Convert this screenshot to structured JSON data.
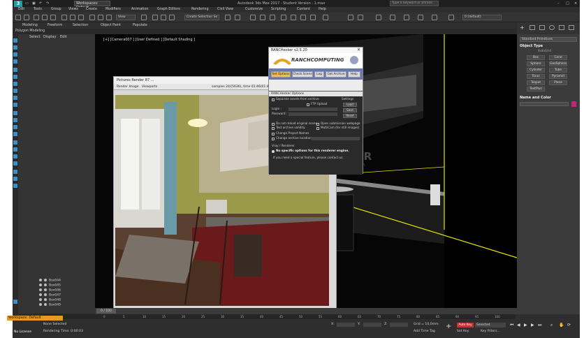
{
  "window": {
    "title": "Autodesk 3ds Max 2017 - Student Version  :  1.max",
    "logo_text": "3",
    "workspace_label": "Workspaces: Default",
    "search_placeholder": "Type a keyword or phrase"
  },
  "menu": {
    "items": [
      "Edit",
      "Tools",
      "Group",
      "Views",
      "Create",
      "Modifiers",
      "Animation",
      "Graph Editors",
      "Rendering",
      "Civil View",
      "Customize",
      "Scripting",
      "Content",
      "Help"
    ]
  },
  "toolbar": {
    "view_dropdown": "View",
    "selection_set_placeholder": "Create Selection Se",
    "layer_default": "0 (default)"
  },
  "ribbon": {
    "tabs": [
      "Modeling",
      "Freeform",
      "Selection",
      "Object Paint",
      "Populate"
    ],
    "sub_label": "Polygon Modeling"
  },
  "scene_explorer": {
    "menu": [
      "Select",
      "Display",
      "Edit"
    ],
    "rows": [
      "Box044",
      "Box045",
      "Box046",
      "Box047",
      "Box048",
      "Box049"
    ]
  },
  "viewport": {
    "label": "[+] [Camera007 ] [User Defined ] [Default Shading ]",
    "watermark": "FILECR",
    "watermark_sub": ".com"
  },
  "frame_buffer": {
    "title": "Pictures Render 87 ...",
    "area_label": "Render Image",
    "area_value": "Viewports",
    "status": "samples 24/(5636), time 01:46(01:49:00), noise 3%"
  },
  "ranch": {
    "title": "RANCHecker v2.5.20",
    "brand": "RANCHCOMPUTING",
    "tabs": [
      "Set Options",
      "Check Scene",
      "Log",
      "Get Archive",
      "Help"
    ],
    "options_title": "RANCHecker Options",
    "separate_assets": "Separate assets from archive",
    "settings_label": "Settings",
    "ftp_upload": "FTP Upload",
    "login_label": "Login :",
    "password_label": "Password :",
    "btn_load": "Load",
    "btn_save": "Save",
    "btn_reset": "Reset",
    "do_not_reload": "Do not reload original scene",
    "open_webpage": "Open submission webpage",
    "test_archive": "Test archive validity",
    "multicam": "MultiCam (for still images)",
    "change_names": "Change Project Names",
    "change_archive": "Change archive location",
    "renderer_section": "Vray / Renderer",
    "no_specific": "No specific options for this renderer engine.",
    "special_feature": "If you need a special feature, please contact us."
  },
  "command_panel": {
    "category": "Standard Primitives",
    "object_type_title": "Object Type",
    "autogrid": "AutoGrid",
    "primitives": [
      "Box",
      "Cone",
      "Sphere",
      "GeoSphere",
      "Cylinder",
      "Tube",
      "Torus",
      "Pyramid",
      "Teapot",
      "Plane",
      "TextPlus"
    ],
    "name_color_title": "Name and Color"
  },
  "timeline": {
    "frame_label": "0 / 100",
    "ticks": [
      "0",
      "5",
      "10",
      "15",
      "20",
      "25",
      "30",
      "35",
      "40",
      "45",
      "50",
      "55",
      "60",
      "65",
      "70",
      "75",
      "80",
      "85",
      "90",
      "95",
      "100"
    ]
  },
  "status": {
    "workspace": "Workspace: Default",
    "none_selected": "None Selected",
    "rendering_time": "Rendering Time: 0:00:03",
    "grid": "Grid = 10,0mm",
    "add_time_tag": "Add Time Tag",
    "auto_key": "Auto Key",
    "set_key": "Set Key",
    "selected": "Selected",
    "key_filters": "Key Filters...",
    "x_label": "X:",
    "y_label": "Y:",
    "z_label": "Z:",
    "no_license": "No License"
  }
}
